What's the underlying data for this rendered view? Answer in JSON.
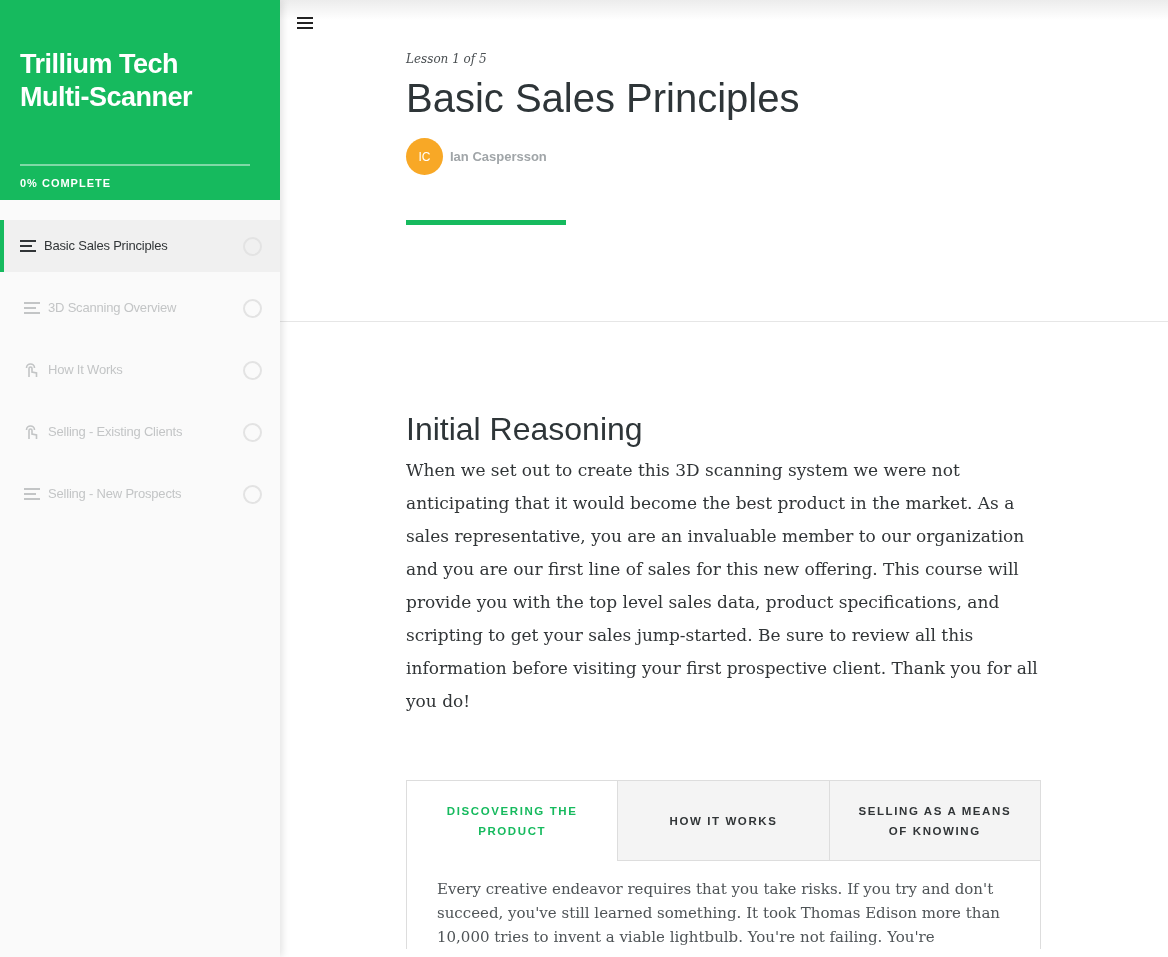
{
  "sidebar": {
    "course_title": "Trillium Tech Multi-Scanner",
    "progress": {
      "level": 0,
      "label": "0% COMPLETE"
    },
    "items": [
      {
        "label": "Basic Sales Principles",
        "kind": "text",
        "selected": true,
        "locked": false,
        "completed": false
      },
      {
        "label": "3D Scanning Overview",
        "kind": "text",
        "selected": false,
        "locked": true,
        "completed": false
      },
      {
        "label": "How It Works",
        "kind": "interactive",
        "selected": false,
        "locked": true,
        "completed": false
      },
      {
        "label": "Selling - Existing Clients",
        "kind": "interactive",
        "selected": false,
        "locked": true,
        "completed": false
      },
      {
        "label": "Selling - New Prospects",
        "kind": "text",
        "selected": false,
        "locked": true,
        "completed": false
      }
    ]
  },
  "lesson": {
    "counter": "Lesson 1 of 5",
    "title": "Basic Sales Principles",
    "author": {
      "initials": "IC",
      "name": "Ian Caspersson"
    }
  },
  "section": {
    "heading": "Initial Reasoning",
    "paragraph": "When we set out to create this 3D scanning system we were not anticipating that it would become the best product in the market. As a sales representative, you are an invaluable member to our organization and you are our first line of sales for this new offering. This course will provide you with the top level sales data, product specifications, and scripting to get your sales jump-started. Be sure to review all this information before visiting your first prospective client. Thank you for all you do!"
  },
  "tabs": [
    {
      "label": "DISCOVERING THE PRODUCT",
      "selected": true
    },
    {
      "label": "HOW IT WORKS",
      "selected": false
    },
    {
      "label": "SELLING AS A MEANS OF KNOWING",
      "selected": false
    }
  ],
  "tab_content": "Every creative endeavor requires that you take risks. If you try and don't succeed, you've still learned something. It took Thomas Edison more than 10,000 tries to invent a viable lightbulb. You're not failing. You're"
}
